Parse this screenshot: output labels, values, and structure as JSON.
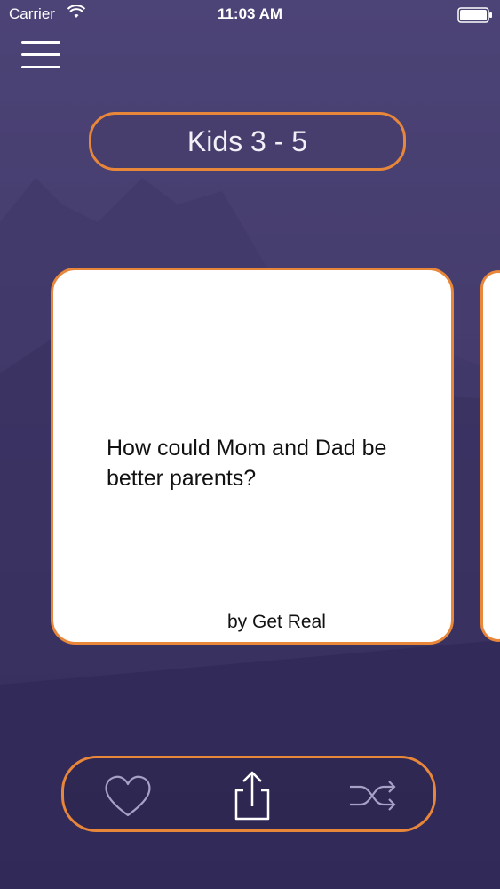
{
  "status_bar": {
    "carrier": "Carrier",
    "time": "11:03 AM"
  },
  "header": {
    "category": "Kids 3 - 5"
  },
  "card": {
    "question": "How could Mom and Dad be better parents?",
    "attribution": "by Get Real"
  },
  "actions": {
    "icons": [
      "heart-icon",
      "share-icon",
      "shuffle-icon"
    ]
  },
  "colors": {
    "accent": "#e8873a",
    "background": "#453c6d",
    "card": "#ffffff"
  }
}
